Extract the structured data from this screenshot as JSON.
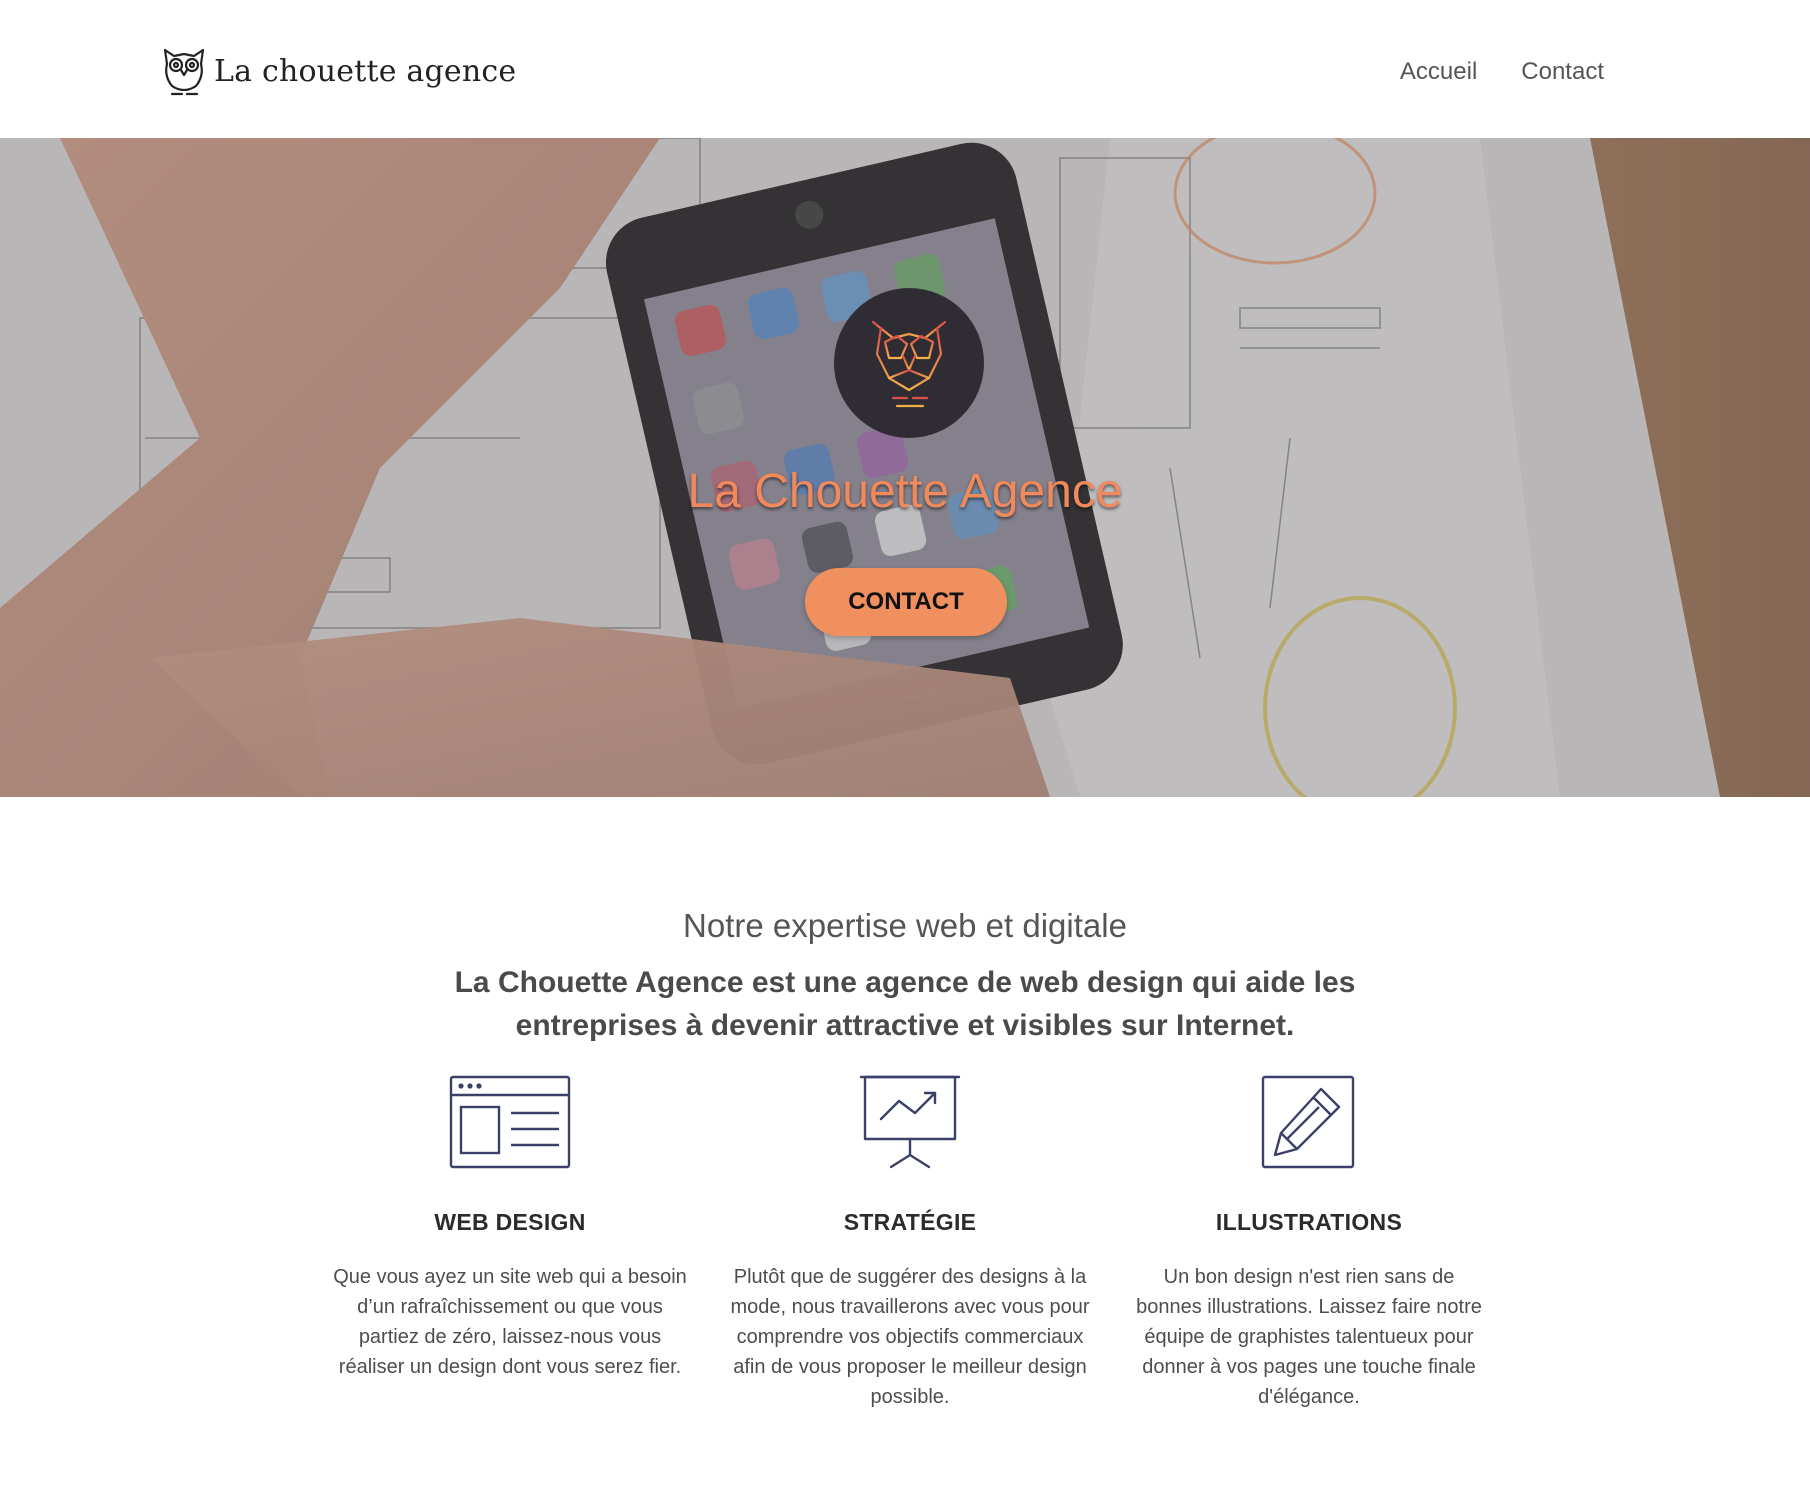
{
  "header": {
    "logo_text": "La chouette agence",
    "nav": [
      "Accueil",
      "Contact"
    ]
  },
  "hero": {
    "title": "La Chouette Agence",
    "button_label": "CONTACT"
  },
  "expertise": {
    "title": "Notre expertise web et digitale",
    "lead": "La Chouette Agence est une agence de web design qui aide les entreprises à devenir attractive et visibles sur Internet.",
    "cards": [
      {
        "icon": "webpage-layout-icon",
        "title": "WEB DESIGN",
        "text": "Que vous ayez un site web qui a besoin d’un rafraîchissement ou que vous partiez de zéro, laissez-nous vous réaliser un design dont vous serez fier."
      },
      {
        "icon": "presentation-chart-icon",
        "title": "STRATÉGIE",
        "text": "Plutôt que de suggérer des designs à la mode, nous travaillerons avec vous pour comprendre vos objectifs commerciaux afin de vous proposer le meilleur design possible."
      },
      {
        "icon": "pencil-square-icon",
        "title": "ILLUSTRATIONS",
        "text": "Un bon design n'est rien sans de bonnes illustrations. Laissez faire notre équipe de graphistes talentueux pour donner à vos pages une touche finale d'élégance."
      }
    ]
  },
  "colors": {
    "accent": "#f1905f",
    "icon_stroke": "#3a4068",
    "badge_bg": "#2f2d33"
  }
}
